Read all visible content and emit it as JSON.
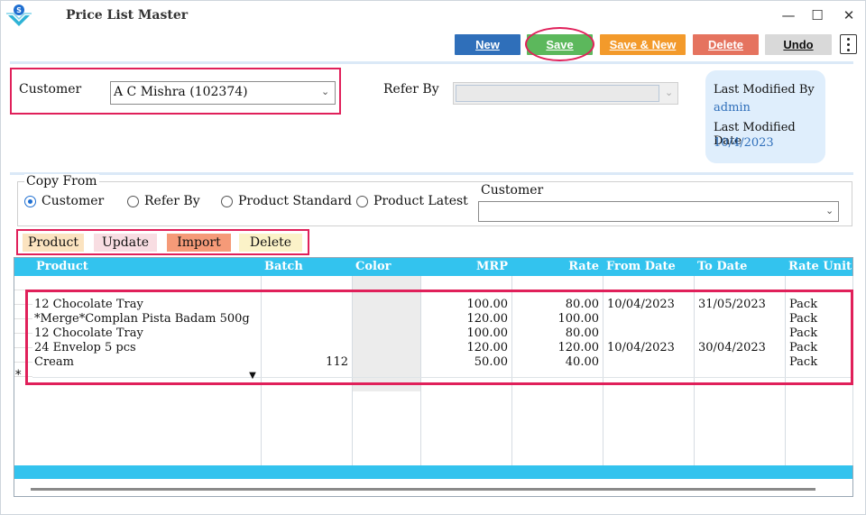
{
  "window": {
    "title": "Price List Master",
    "controls": {
      "minimize": "—",
      "maximize": "☐",
      "close": "✕"
    }
  },
  "toolbar": {
    "new_label": "New",
    "save_label": "Save",
    "save_new_label": "Save & New",
    "delete_label": "Delete",
    "undo_label": "Undo"
  },
  "header": {
    "customer_label": "Customer",
    "customer_value": "A C Mishra (102374)",
    "refer_by_label": "Refer By",
    "refer_by_value": "",
    "last_modified_by_label": "Last Modified By",
    "last_modified_by_value": "admin",
    "last_modified_date_label": "Last Modified Date",
    "last_modified_date_value": "10/4/2023"
  },
  "copy_from": {
    "legend": "Copy From",
    "options": [
      "Customer",
      "Refer By",
      "Product Standard",
      "Product Latest"
    ],
    "selected": "Customer",
    "customer_label": "Customer",
    "customer_value": ""
  },
  "actions": {
    "product_label": "Product",
    "update_label": "Update",
    "import_label": "Import",
    "delete_label": "Delete"
  },
  "grid": {
    "columns": [
      "Product",
      "Batch",
      "Color",
      "MRP",
      "Rate",
      "From Date",
      "To Date",
      "Rate Unit"
    ],
    "rows": [
      {
        "product": "12 Chocolate Tray",
        "batch": "",
        "color": "",
        "mrp": "100.00",
        "rate": "80.00",
        "from_date": "10/04/2023",
        "to_date": "31/05/2023",
        "rate_unit": "Pack"
      },
      {
        "product": "*Merge*Complan Pista Badam 500g",
        "batch": "",
        "color": "",
        "mrp": "120.00",
        "rate": "100.00",
        "from_date": "",
        "to_date": "",
        "rate_unit": "Pack"
      },
      {
        "product": "12 Chocolate Tray",
        "batch": "",
        "color": "",
        "mrp": "100.00",
        "rate": "80.00",
        "from_date": "",
        "to_date": "",
        "rate_unit": "Pack"
      },
      {
        "product": "24 Envelop 5 pcs",
        "batch": "",
        "color": "",
        "mrp": "120.00",
        "rate": "120.00",
        "from_date": "10/04/2023",
        "to_date": "30/04/2023",
        "rate_unit": "Pack"
      },
      {
        "product": "Cream",
        "batch": "112",
        "color": "",
        "mrp": "50.00",
        "rate": "40.00",
        "from_date": "",
        "to_date": "",
        "rate_unit": "Pack"
      }
    ],
    "new_row_marker": "*"
  },
  "colors": {
    "accent_blue": "#2f6fba",
    "save_green": "#5cb85c",
    "save_new_orange": "#f39a2b",
    "delete_red": "#e5735f",
    "grid_header_cyan": "#33c3ee",
    "highlight_pink": "#e0205a"
  }
}
